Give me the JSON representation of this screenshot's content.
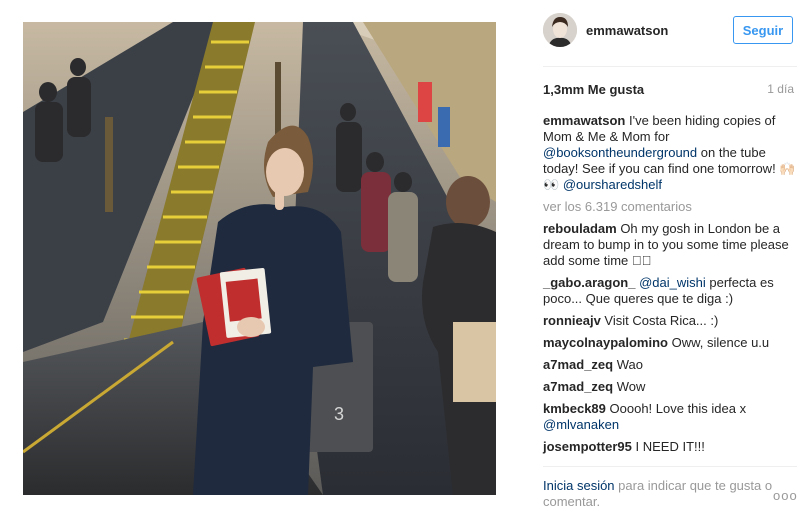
{
  "post": {
    "username": "emmawatson",
    "follow_label": "Seguir",
    "likes": "1,3mm Me gusta",
    "age": "1 día",
    "caption": {
      "username": "emmawatson",
      "text_1": "I've been hiding copies of Mom & Me & Mom for ",
      "mention_1": "@booksontheunderground",
      "text_2": " on the tube today! See if you can find one tomorrow! ",
      "emoji": "🙌🏻👀",
      "mention_2": "@oursharedshelf"
    },
    "view_comments": "ver los 6.319 comentarios",
    "comments": [
      {
        "user": "rebouladam",
        "text": "Oh my gosh in London be a dream to bump in to you some time please add some time 🏻🏻"
      },
      {
        "user": "_gabo.aragon_",
        "mention": "@dai_wishi",
        "text": " perfecta es poco... Que queres que te diga :)"
      },
      {
        "user": "ronnieajv",
        "text": "Visit Costa Rica... :)"
      },
      {
        "user": "maycolnaypalomino",
        "text": "Oww, silence u.u"
      },
      {
        "user": "a7mad_zeq",
        "text": "Wao"
      },
      {
        "user": "a7mad_zeq",
        "text": "Wow"
      },
      {
        "user": "kmbeck89",
        "text": "Ooooh! Love this idea x ",
        "mention": "@mlvanaken"
      },
      {
        "user": "josempotter95",
        "text": "I NEED IT!!!"
      }
    ],
    "footer": {
      "login": "Inicia sesión",
      "text": " para indicar que te gusta o comentar.",
      "more": "ooo"
    },
    "photo_sign": "3",
    "icons": {
      "avatar": "profile-avatar",
      "more": "more-options-icon"
    }
  }
}
